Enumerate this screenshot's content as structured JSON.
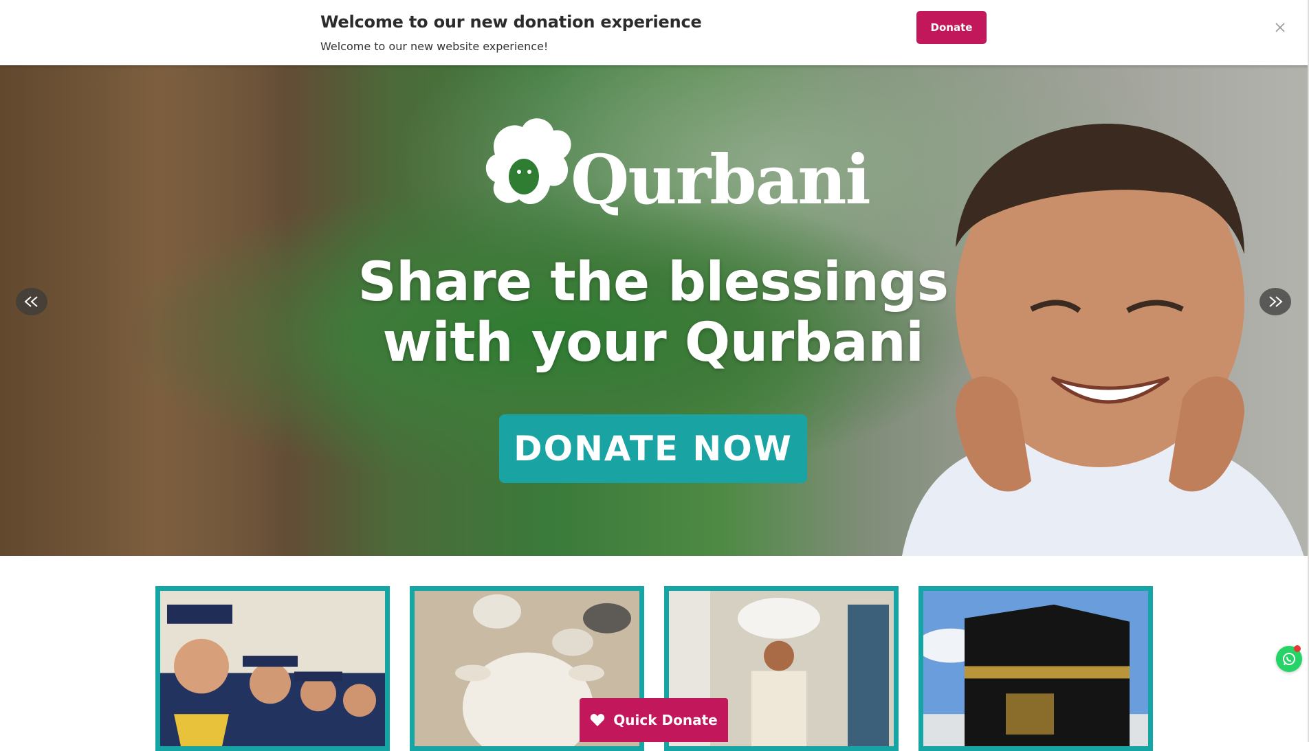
{
  "announcement": {
    "title": "Welcome to our new donation experience",
    "subtitle": "Welcome to our new website experience!",
    "donate_label": "Donate",
    "close_icon": "close-icon",
    "accent_color": "#c2185b"
  },
  "hero": {
    "logo_text": "Qurbani",
    "logo_icon": "sheep-icon",
    "headline_line1": "Share the blessings",
    "headline_line2": "with your Qurbani",
    "cta_label": "DONATE NOW",
    "cta_color": "#1aa3a3",
    "prev_icon": "double-chevron-left-icon",
    "next_icon": "double-chevron-right-icon"
  },
  "cards": [
    {
      "name": "graduating-children"
    },
    {
      "name": "sheep"
    },
    {
      "name": "child-carrying-sack"
    },
    {
      "name": "kaaba"
    }
  ],
  "card_border_color": "#16a5a5",
  "quick_donate": {
    "label": "Quick Donate",
    "icon": "heart-icon"
  },
  "whatsapp": {
    "icon": "whatsapp-icon"
  }
}
